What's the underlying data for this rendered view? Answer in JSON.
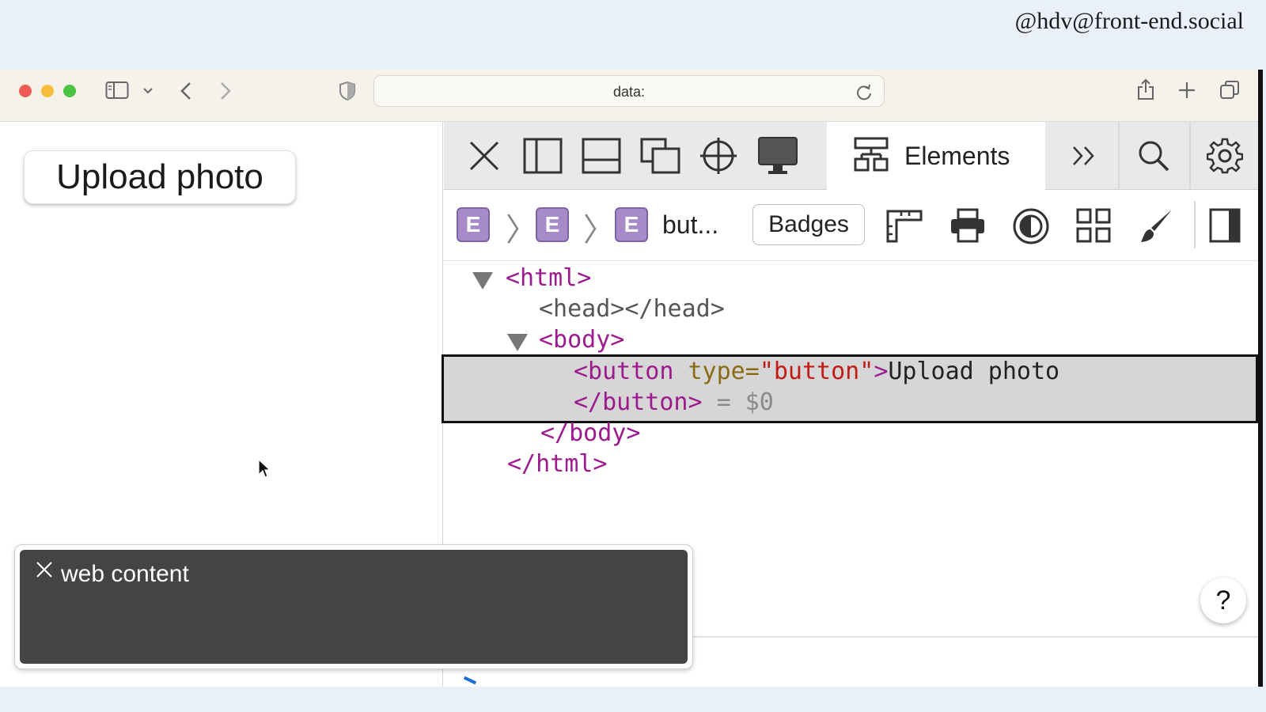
{
  "handle": "@hdv@front-end.social",
  "browser": {
    "url": "data:",
    "icons": [
      "sidebar-icon",
      "chevron-down-icon",
      "back-icon",
      "forward-icon",
      "shield-icon",
      "reload-icon",
      "share-icon",
      "new-tab-icon",
      "tabs-overview-icon"
    ]
  },
  "page": {
    "button_label": "Upload photo"
  },
  "devtools": {
    "tab_label": "Elements",
    "crumb_letter": "E",
    "crumb_last": "but...",
    "badges_label": "Badges",
    "help_label": "?",
    "tree": {
      "html_open": "<html>",
      "head": "<head></head>",
      "body_open": "<body>",
      "button_open": "<button",
      "button_attr": " type=",
      "button_val": "\"button\"",
      "button_close_bracket": ">",
      "button_text": "Upload photo",
      "button_end": "</button>",
      "button_ref": " = $0",
      "body_close": "</body>",
      "html_close": "</html>"
    }
  },
  "toast": {
    "label": "web content"
  },
  "colors": {
    "tag": "#9c1a8e",
    "attr": "#8a6a12",
    "value": "#c41a16",
    "badge": "#a68ac9"
  }
}
